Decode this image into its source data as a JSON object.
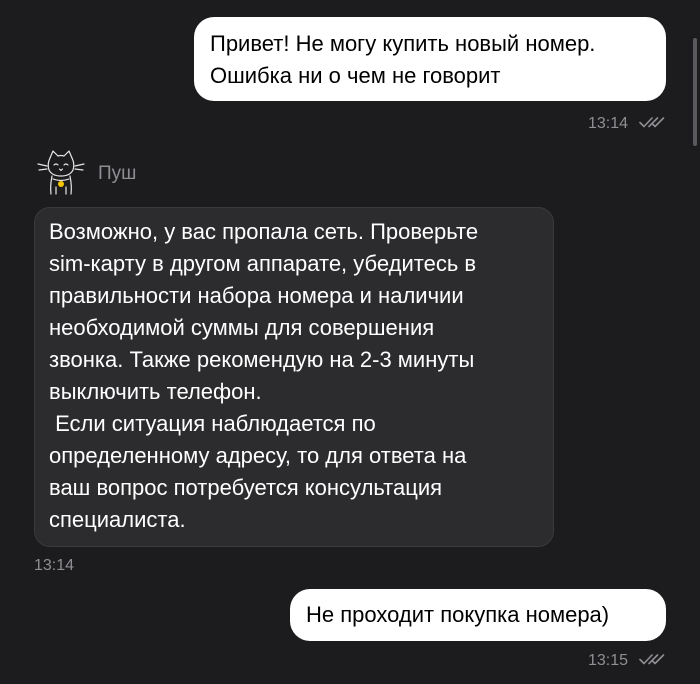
{
  "messages": {
    "outgoing_1": {
      "lines": [
        "Привет! Не могу купить новый номер.",
        "Ошибка ни о чем не говорит"
      ],
      "time": "13:14",
      "status_icon": "double-check-icon"
    },
    "incoming_1": {
      "sender": "Пуш",
      "avatar_icon": "cat-logo-icon",
      "lines": [
        "Возможно, у вас пропала сеть. Проверьте",
        "sim-карту в другом аппарате, убедитесь в",
        "правильности набора номера и наличии",
        "необходимой суммы для совершения",
        "звонка. Также рекомендую на 2-3 минуты",
        "выключить телефон.",
        " Если ситуация наблюдается по",
        "определенному адресу, то для ответа на",
        "ваш вопрос потребуется консультация",
        "специалиста."
      ],
      "time": "13:14"
    },
    "outgoing_2": {
      "text": "Не проходит покупка номера)",
      "time": "13:15",
      "status_icon": "double-check-icon"
    }
  },
  "colors": {
    "background": "#1c1c1e",
    "outgoing_bubble": "#ffffff",
    "incoming_bubble": "#2c2c2e",
    "meta_text": "#8e8e93"
  }
}
